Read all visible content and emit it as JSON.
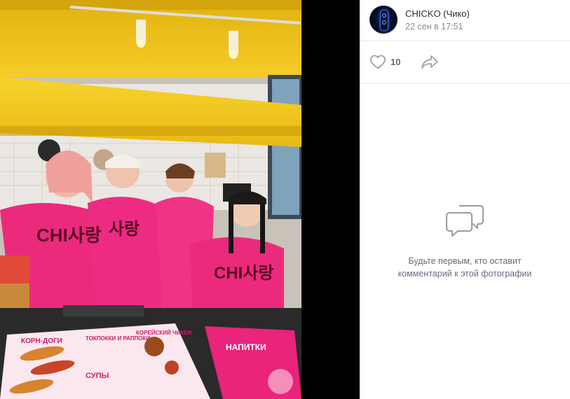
{
  "post": {
    "author_name": "CHICKO (Чико)",
    "date": "22 сен в 17:51",
    "likes": "10"
  },
  "comments": {
    "empty_text": "Будьте первым, кто оставит комментарий к этой фотографии"
  },
  "photo": {
    "shirt_text_1": "CHI사랑",
    "shirt_text_2": "사랑",
    "shirt_text_3": "CHI사랑",
    "menu_item_1": "КОРН-ДОГИ",
    "menu_item_2": "ТОКПОККИ И РАППОКИ",
    "menu_item_3": "КОРЕЙСКИЙ ЧИКЕН",
    "menu_item_4": "СУПЫ",
    "menu_item_5": "НАПИТКИ"
  },
  "colors": {
    "accent": "#0077ff",
    "icon_gray": "#99a2ad",
    "text_secondary": "#818c99",
    "shirt_pink": "#ec2a7c",
    "ceiling_yellow": "#f2c319"
  },
  "icons": {
    "like": "heart-outline-icon",
    "share": "share-arrow-icon",
    "no_comments": "speech-bubbles-icon"
  }
}
